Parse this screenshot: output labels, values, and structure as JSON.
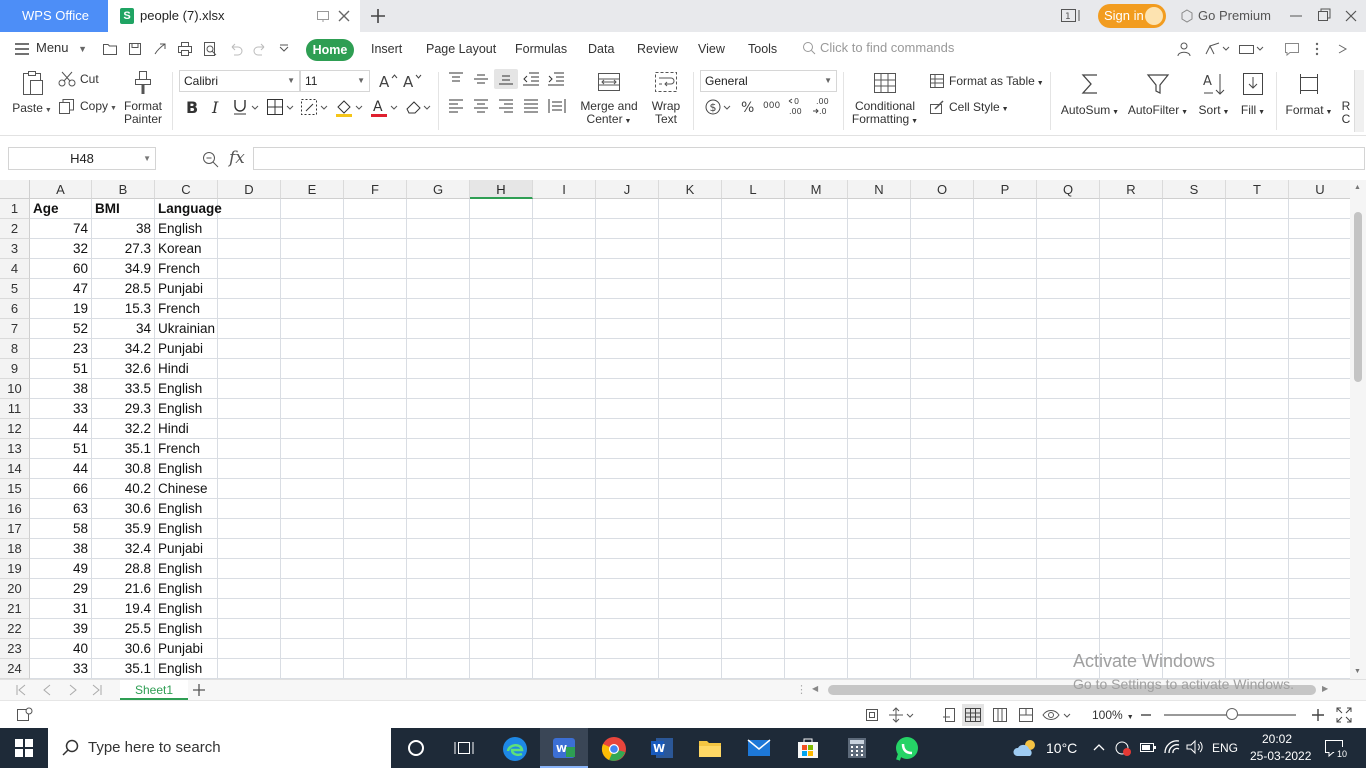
{
  "titlebar": {
    "app_name": "WPS Office",
    "file_tab": "people (7).xlsx",
    "file_icon_letter": "S",
    "sign_in": "Sign in",
    "go_premium": "Go Premium"
  },
  "menubar": {
    "menu_label": "Menu",
    "tabs": [
      "Home",
      "Insert",
      "Page Layout",
      "Formulas",
      "Data",
      "Review",
      "View",
      "Tools"
    ],
    "find_placeholder": "Click to find commands"
  },
  "ribbon": {
    "paste": "Paste",
    "cut": "Cut",
    "copy": "Copy",
    "format_painter_line1": "Format",
    "format_painter_line2": "Painter",
    "font_name": "Calibri",
    "font_size": "11",
    "merge_line1": "Merge and",
    "merge_line2": "Center",
    "wrap_line1": "Wrap",
    "wrap_line2": "Text",
    "number_format": "General",
    "cond_line1": "Conditional",
    "cond_line2": "Formatting",
    "format_as_table": "Format as Table",
    "cell_style": "Cell Style",
    "autosum": "AutoSum",
    "autofilter": "AutoFilter",
    "sort": "Sort",
    "fill": "Fill",
    "format": "Format",
    "cut_off_line1": "R",
    "cut_off_line2": "C"
  },
  "formula_bar": {
    "name_box": "H48",
    "fx": "fx",
    "formula": ""
  },
  "sheet": {
    "columns": [
      "A",
      "B",
      "C",
      "D",
      "E",
      "F",
      "G",
      "H",
      "I",
      "J",
      "K",
      "L",
      "M",
      "N",
      "O",
      "P",
      "Q",
      "R",
      "S",
      "T",
      "U"
    ],
    "selected_column": "H",
    "rows": [
      [
        "1",
        "Age",
        "BMI",
        "Language"
      ],
      [
        "2",
        "74",
        "38",
        "English"
      ],
      [
        "3",
        "32",
        "27.3",
        "Korean"
      ],
      [
        "4",
        "60",
        "34.9",
        "French"
      ],
      [
        "5",
        "47",
        "28.5",
        "Punjabi"
      ],
      [
        "6",
        "19",
        "15.3",
        "French"
      ],
      [
        "7",
        "52",
        "34",
        "Ukrainian"
      ],
      [
        "8",
        "23",
        "34.2",
        "Punjabi"
      ],
      [
        "9",
        "51",
        "32.6",
        "Hindi"
      ],
      [
        "10",
        "38",
        "33.5",
        "English"
      ],
      [
        "11",
        "33",
        "29.3",
        "English"
      ],
      [
        "12",
        "44",
        "32.2",
        "Hindi"
      ],
      [
        "13",
        "51",
        "35.1",
        "French"
      ],
      [
        "14",
        "44",
        "30.8",
        "English"
      ],
      [
        "15",
        "66",
        "40.2",
        "Chinese"
      ],
      [
        "16",
        "63",
        "30.6",
        "English"
      ],
      [
        "17",
        "58",
        "35.9",
        "English"
      ],
      [
        "18",
        "38",
        "32.4",
        "Punjabi"
      ],
      [
        "19",
        "49",
        "28.8",
        "English"
      ],
      [
        "20",
        "29",
        "21.6",
        "English"
      ],
      [
        "21",
        "31",
        "19.4",
        "English"
      ],
      [
        "22",
        "39",
        "25.5",
        "English"
      ],
      [
        "23",
        "40",
        "30.6",
        "Punjabi"
      ],
      [
        "24",
        "33",
        "35.1",
        "English"
      ]
    ],
    "sheet_tab": "Sheet1"
  },
  "watermark": {
    "line1": "Activate Windows",
    "line2": "Go to Settings to activate Windows."
  },
  "statusbar": {
    "zoom": "100%"
  },
  "taskbar": {
    "search_placeholder": "Type here to search",
    "weather": "10°C",
    "language": "ENG",
    "time": "20:02",
    "date": "25-03-2022",
    "notifications": "10"
  },
  "colors": {
    "wps_blue": "#4d8ef7",
    "accent_green": "#2e9e53",
    "signin_orange": "#f29c1f",
    "taskbar": "#1e2a38"
  }
}
